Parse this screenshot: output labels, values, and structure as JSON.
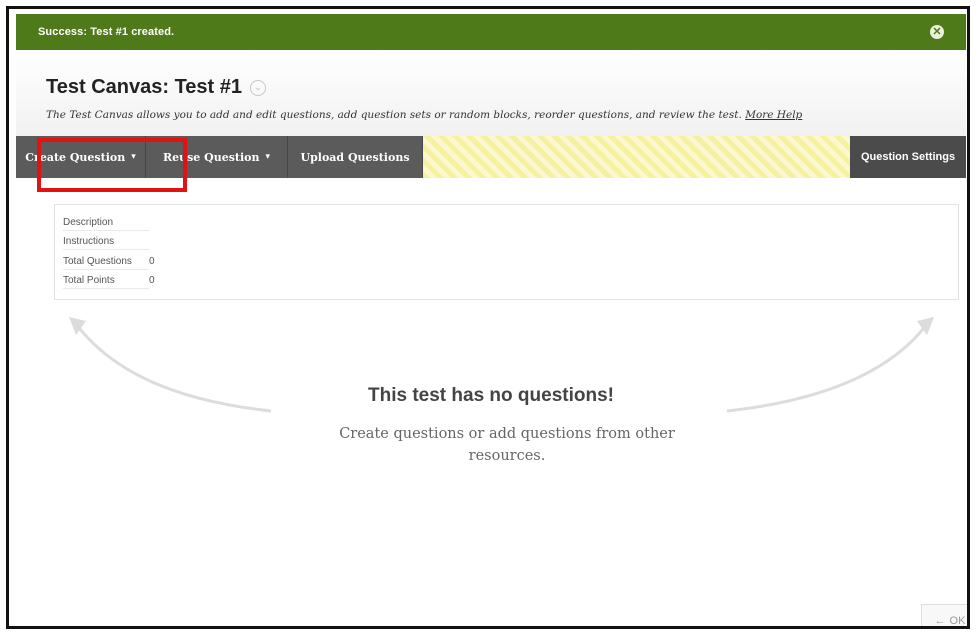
{
  "notification": {
    "message": "Success: Test #1 created.",
    "close_icon": "close-icon"
  },
  "header": {
    "title": "Test Canvas: Test #1",
    "description": "The Test Canvas allows you to add and edit questions, add question sets or random blocks, reorder questions, and review the test.",
    "more_help": "More Help"
  },
  "toolbar": {
    "create_question": "Create Question",
    "reuse_question": "Reuse Question",
    "upload_questions": "Upload Questions",
    "question_settings": "Question Settings"
  },
  "info": {
    "rows": [
      {
        "label": "Description",
        "value": ""
      },
      {
        "label": "Instructions",
        "value": ""
      },
      {
        "label": "Total Questions",
        "value": "0"
      },
      {
        "label": "Total Points",
        "value": "0"
      }
    ]
  },
  "empty_state": {
    "title": "This test has no questions!",
    "subtitle": "Create questions or add questions from other resources."
  },
  "footer": {
    "ok_label": "OK"
  },
  "colors": {
    "success_green": "#4f7a1a",
    "toolbar_gray": "#5b5b5b",
    "highlight_red": "#e31212",
    "stripe_yellow": "#f6f1a0"
  }
}
